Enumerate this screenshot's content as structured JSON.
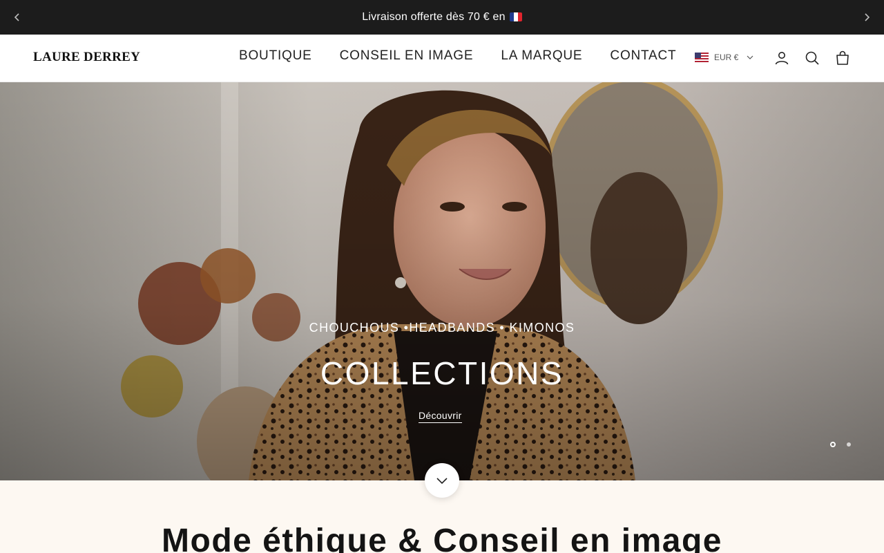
{
  "announcement": {
    "message": "Livraison offerte dès 70 € en",
    "flag_icon": "france-flag-icon",
    "prev_icon": "chevron-left-icon",
    "next_icon": "chevron-right-icon"
  },
  "header": {
    "logo": "LAURE DERREY",
    "nav": [
      {
        "label": "BOUTIQUE"
      },
      {
        "label": "CONSEIL EN IMAGE"
      },
      {
        "label": "LA MARQUE"
      },
      {
        "label": "CONTACT"
      }
    ],
    "currency": "EUR €",
    "currency_flag_icon": "us-flag-icon",
    "icons": [
      "account-icon",
      "search-icon",
      "bag-icon"
    ]
  },
  "hero": {
    "subtitle": "CHOUCHOUS •HEADBANDS • KIMONOS",
    "title": "COLLECTIONS",
    "link_label": "Découvrir",
    "slide_count": 2,
    "active_slide": 1
  },
  "section": {
    "heading": "Mode éthique & Conseil en image"
  },
  "colors": {
    "announcement_bg": "#1c1c1c",
    "page_bg": "#fdf8f2",
    "text": "#141414"
  }
}
